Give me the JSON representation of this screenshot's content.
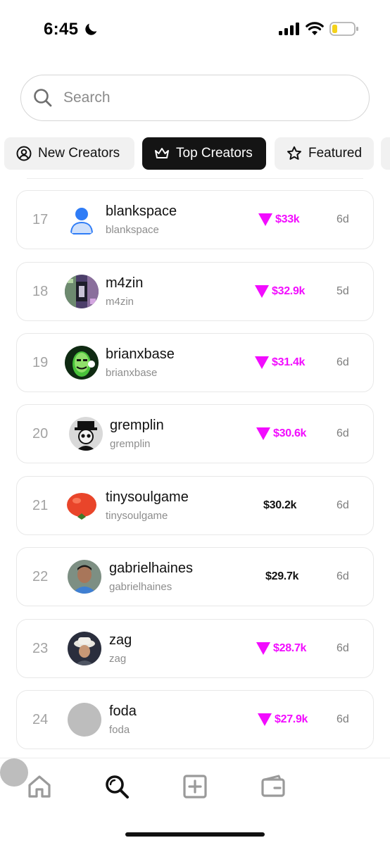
{
  "status_bar": {
    "time": "6:45"
  },
  "search": {
    "placeholder": "Search",
    "value": ""
  },
  "tabs": [
    {
      "label": "New Creators",
      "icon": "user-circle-icon",
      "active": false
    },
    {
      "label": "Top Creators",
      "icon": "crown-icon",
      "active": true
    },
    {
      "label": "Featured",
      "icon": "star-icon",
      "active": false
    }
  ],
  "colors": {
    "accent_down": "#f20cff",
    "active_tab_bg": "#141414",
    "avatar_placeholder": "#bdbdbd"
  },
  "creators": [
    {
      "rank": "17",
      "name": "blankspace",
      "handle": "blankspace",
      "value": "$33k",
      "trend": "down",
      "age": "6d",
      "avatar": "default-user-avatar"
    },
    {
      "rank": "18",
      "name": "m4zin",
      "handle": "m4zin",
      "value": "$32.9k",
      "trend": "down",
      "age": "5d",
      "avatar": "photo-avatar"
    },
    {
      "rank": "19",
      "name": "brianxbase",
      "handle": "brianxbase",
      "value": "$31.4k",
      "trend": "down",
      "age": "6d",
      "avatar": "green-character-avatar"
    },
    {
      "rank": "20",
      "name": "gremplin",
      "handle": "gremplin",
      "value": "$30.6k",
      "trend": "down",
      "age": "6d",
      "avatar": "skull-hat-avatar"
    },
    {
      "rank": "21",
      "name": "tinysoulgame",
      "handle": "tinysoulgame",
      "value": "$30.2k",
      "trend": "flat",
      "age": "6d",
      "avatar": "tomato-avatar"
    },
    {
      "rank": "22",
      "name": "gabrielhaines",
      "handle": "gabrielhaines",
      "value": "$29.7k",
      "trend": "flat",
      "age": "6d",
      "avatar": "person-photo-avatar"
    },
    {
      "rank": "23",
      "name": "zag",
      "handle": "zag",
      "value": "$28.7k",
      "trend": "down",
      "age": "6d",
      "avatar": "bucket-hat-avatar"
    },
    {
      "rank": "24",
      "name": "foda",
      "handle": "foda",
      "value": "$27.9k",
      "trend": "down",
      "age": "6d",
      "avatar": "empty-gray-avatar"
    }
  ],
  "bottom_nav": [
    {
      "icon": "home-icon"
    },
    {
      "icon": "search-icon",
      "active": true
    },
    {
      "icon": "plus-square-icon"
    },
    {
      "icon": "wallet-icon"
    },
    {
      "icon": "profile-avatar"
    }
  ]
}
